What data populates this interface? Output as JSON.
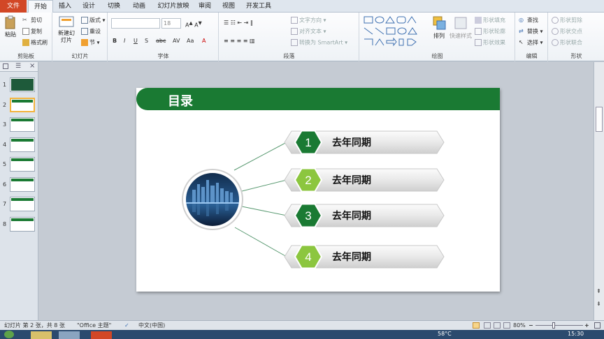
{
  "tabs": [
    "文件",
    "开始",
    "插入",
    "设计",
    "切换",
    "动画",
    "幻灯片放映",
    "审阅",
    "视图",
    "开发工具"
  ],
  "ribbon": {
    "clipboard": {
      "paste": "粘贴",
      "cut": "剪切",
      "copy": "复制",
      "format_painter": "格式刷",
      "label": "剪贴板"
    },
    "slides": {
      "new_slide": "新建幻灯片",
      "layout": "版式",
      "reset": "重设",
      "section": "节",
      "label": "幻灯片"
    },
    "font": {
      "size": "18",
      "label": "字体"
    },
    "paragraph": {
      "text_direction": "文字方向",
      "align_text": "对齐文本",
      "smartart": "转换为 SmartArt",
      "label": "段落"
    },
    "drawing": {
      "arrange": "排列",
      "quick_styles": "快速样式",
      "shape_fill": "形状填充",
      "shape_outline": "形状轮廓",
      "shape_effects": "形状效果",
      "label": "绘图"
    },
    "editing": {
      "find": "查找",
      "replace": "替换",
      "select": "选择",
      "label": "编辑"
    },
    "shape": {
      "subtract": "形状剪除",
      "intersect": "形状交点",
      "union": "形状联合",
      "label": "形状"
    }
  },
  "thumbs": [
    "1",
    "2",
    "3",
    "4",
    "5",
    "6",
    "7",
    "8"
  ],
  "slide": {
    "title": "目录",
    "items": [
      {
        "num": "1",
        "text": "去年同期"
      },
      {
        "num": "2",
        "text": "去年同期"
      },
      {
        "num": "3",
        "text": "去年同期"
      },
      {
        "num": "4",
        "text": "去年同期"
      }
    ]
  },
  "status": {
    "slide_info": "幻灯片 第 2 张，共 8 张",
    "theme": "\"Office 主题\"",
    "lang": "中文(中国)",
    "zoom": "80%"
  },
  "taskbar": {
    "temp": "58°C",
    "time": "15:30"
  },
  "colors": {
    "dark_green": "#1a7a33",
    "light_green": "#8cc63f",
    "file_tab": "#d24726"
  }
}
